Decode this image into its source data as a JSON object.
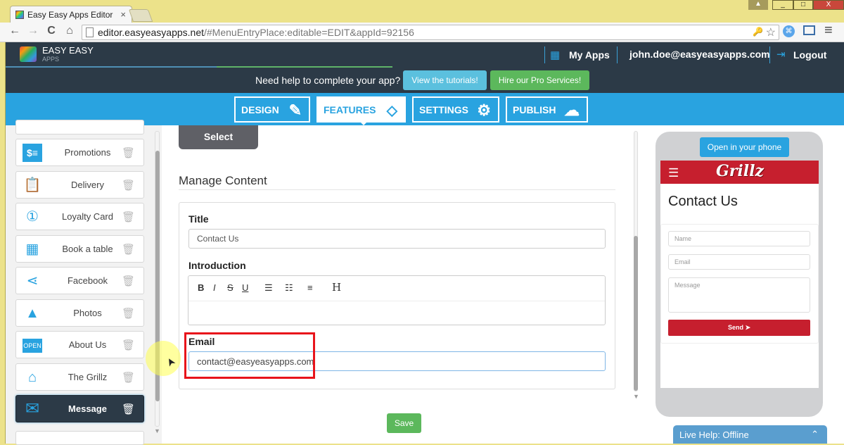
{
  "browser": {
    "tab_title": "Easy Easy Apps Editor",
    "tab_close": "×",
    "url_host": "editor.easyeasyapps.net",
    "url_path": "/#MenuEntryPlace:editable=EDIT&appId=92156",
    "nav_icons": {
      "back": "←",
      "forward": "→",
      "reload": "C",
      "home": "⌂"
    },
    "toolbar_icons": {
      "key": "🔑",
      "star": "☆",
      "extension": "⌘",
      "cast": "▭",
      "menu": "≡"
    },
    "window_controls": {
      "minimize": "_",
      "maximize": "□",
      "close": "X"
    }
  },
  "header": {
    "logo_text": "EASY EASY",
    "logo_sub": "APPS",
    "my_apps": "My Apps",
    "user_email": "john.doe@easyeasyapps.com",
    "logout": "Logout",
    "grid_icon": "▦",
    "logout_icon": "⇥"
  },
  "helpbar": {
    "text": "Need help to complete your app?",
    "tutorials_button": "View the tutorials!",
    "pro_button": "Hire our Pro Services!"
  },
  "nav": {
    "tabs": [
      {
        "label": "DESIGN",
        "icon": "✎"
      },
      {
        "label": "FEATURES",
        "icon": "⬦"
      },
      {
        "label": "SETTINGS",
        "icon": "⚙"
      },
      {
        "label": "PUBLISH",
        "icon": "☁"
      }
    ],
    "active": "FEATURES"
  },
  "sidebar": {
    "items": [
      {
        "label": "Promotions",
        "icon": "$≡"
      },
      {
        "label": "Delivery",
        "icon": "📋"
      },
      {
        "label": "Loyalty Card",
        "icon": "①"
      },
      {
        "label": "Book a table",
        "icon": "▦"
      },
      {
        "label": "Facebook",
        "icon": "⋖"
      },
      {
        "label": "Photos",
        "icon": "▲"
      },
      {
        "label": "About Us",
        "icon": "OPEN"
      },
      {
        "label": "The Grillz",
        "icon": "⌂"
      },
      {
        "label": "Message",
        "icon": "✉"
      }
    ],
    "active": "Message",
    "trash_icon": "🗑"
  },
  "editor": {
    "select_button": "Select",
    "section_title": "Manage Content",
    "title_label": "Title",
    "title_value": "Contact Us",
    "intro_label": "Introduction",
    "intro_value": "",
    "rte_buttons": [
      "B",
      "I",
      "S",
      "U",
      "☰",
      "☷",
      "≡",
      "H"
    ],
    "email_label": "Email",
    "email_value": "contact@easyeasyapps.com",
    "save_button": "Save"
  },
  "preview": {
    "open_phone_button": "Open in your phone",
    "brand": "Grillz",
    "menu_icon": "☰",
    "page_title": "Contact Us",
    "name_placeholder": "Name",
    "email_placeholder": "Email",
    "message_placeholder": "Message",
    "send_button": "Send ➤"
  },
  "livehelp": {
    "label": "Live Help: Offline",
    "chevron": "⌃"
  }
}
